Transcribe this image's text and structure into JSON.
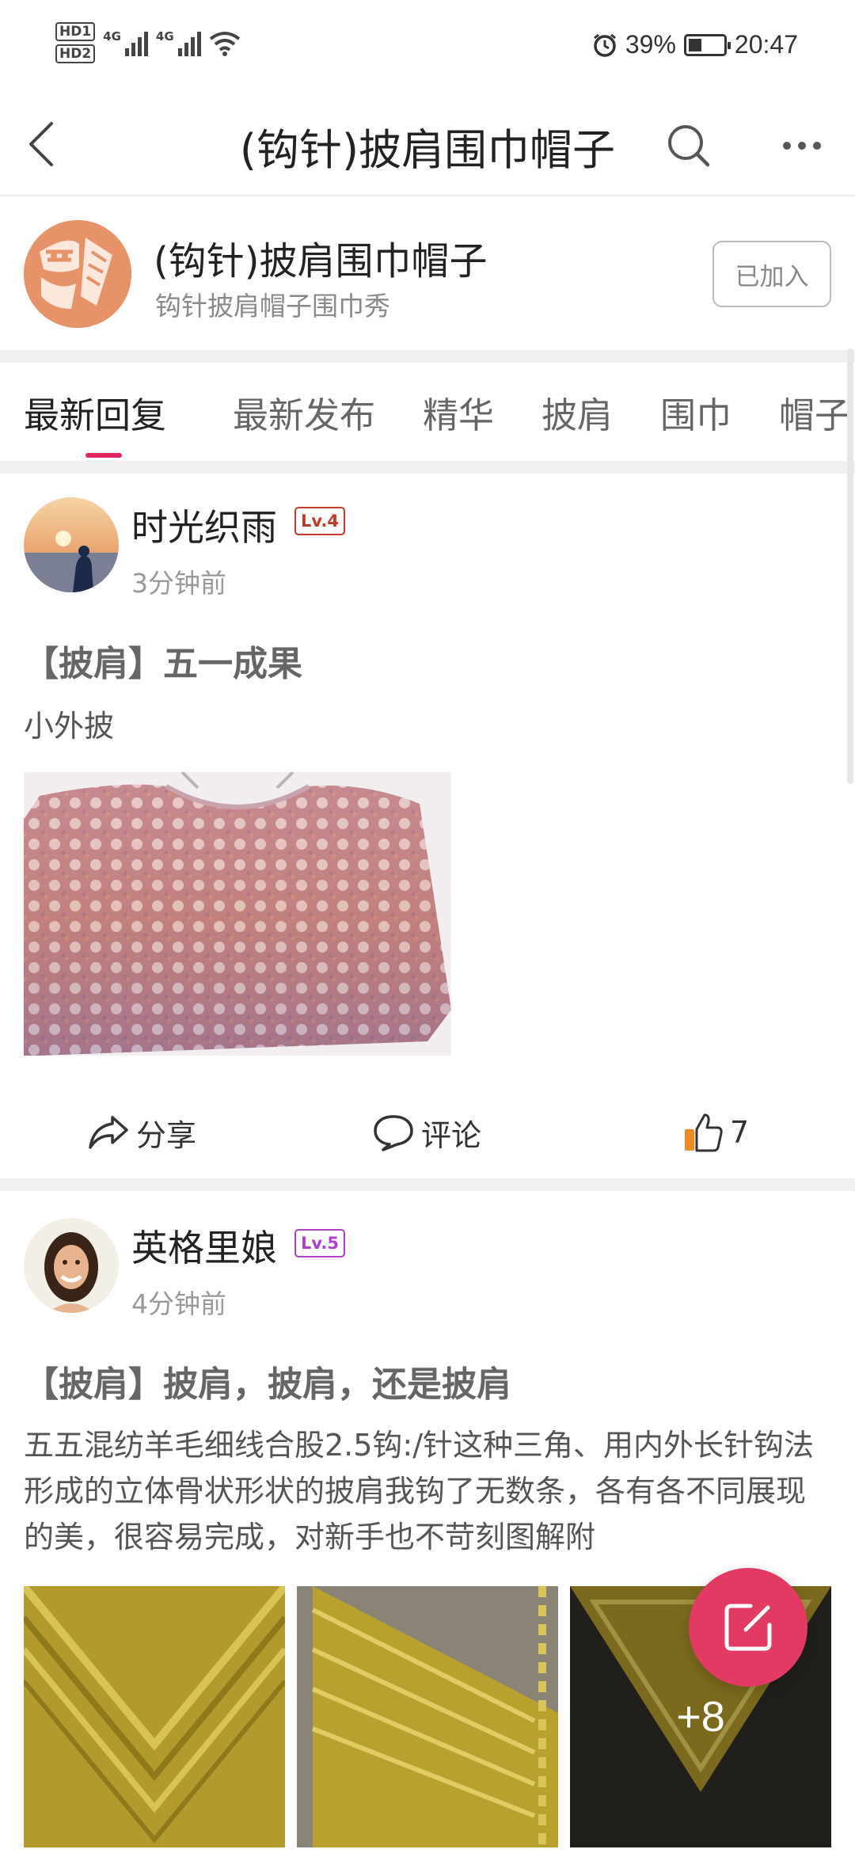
{
  "status_bar": {
    "hd1": "HD1",
    "hd2": "HD2",
    "net1": "4G",
    "net2": "4G",
    "battery_percent": "39%",
    "battery_level": 0.39,
    "time": "20:47",
    "icons": [
      "alarm-icon",
      "wifi-icon",
      "battery-icon",
      "signal-icon"
    ]
  },
  "nav": {
    "title": "(钩针)披肩围巾帽子",
    "icons": [
      "back-icon",
      "search-icon",
      "more-icon"
    ]
  },
  "group": {
    "name": "(钩针)披肩围巾帽子",
    "description": "钩针披肩帽子围巾秀",
    "join_label": "已加入"
  },
  "tabs": [
    "最新回复",
    "最新发布",
    "精华",
    "披肩",
    "围巾",
    "帽子"
  ],
  "active_tab": 0,
  "posts": [
    {
      "author": "时光织雨",
      "level": "Lv.4",
      "time": "3分钟前",
      "title": "【披肩】五一成果",
      "body": "小外披",
      "actions": {
        "share": "分享",
        "comment": "评论",
        "likes": "7"
      }
    },
    {
      "author": "英格里娘",
      "level": "Lv.5",
      "time": "4分钟前",
      "title": "【披肩】披肩，披肩，还是披肩",
      "body": "五五混纺羊毛细线合股2.5钩:/针这种三角、用内外长针钩法形成的立体骨状形状的披肩我钩了无数条，各有各不同展现的美，很容易完成，对新手也不苛刻图解附",
      "more_images": "+8"
    }
  ],
  "colors": {
    "accent": "#e0245e",
    "fab": "#e23a62",
    "level4": "#c0392b",
    "level5": "#b040c8",
    "like": "#f08a24"
  }
}
